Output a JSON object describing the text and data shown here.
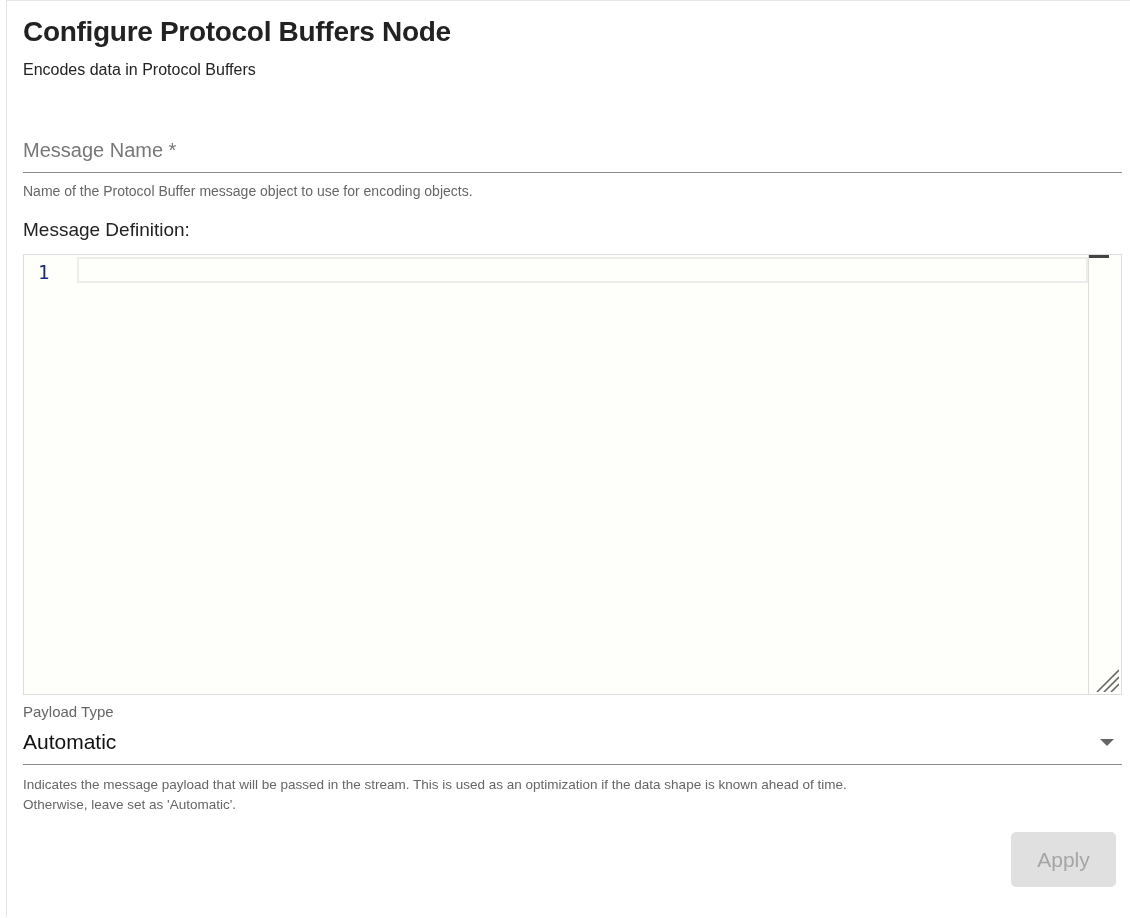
{
  "title": "Configure Protocol Buffers Node",
  "subtitle": "Encodes data in Protocol Buffers",
  "message_name": {
    "placeholder": "Message Name *",
    "helper": "Name of the Protocol Buffer message object to use for encoding objects."
  },
  "message_definition": {
    "label": "Message Definition:",
    "line_numbers": [
      "1"
    ]
  },
  "payload_type": {
    "label": "Payload Type",
    "value": "Automatic",
    "helper_lines": [
      "Indicates the message payload that will be passed in the stream. This is used as an optimization if the data shape is known ahead of time.",
      "Otherwise, leave set as 'Automatic'."
    ]
  },
  "apply_button": {
    "label": "Apply",
    "disabled": true
  }
}
